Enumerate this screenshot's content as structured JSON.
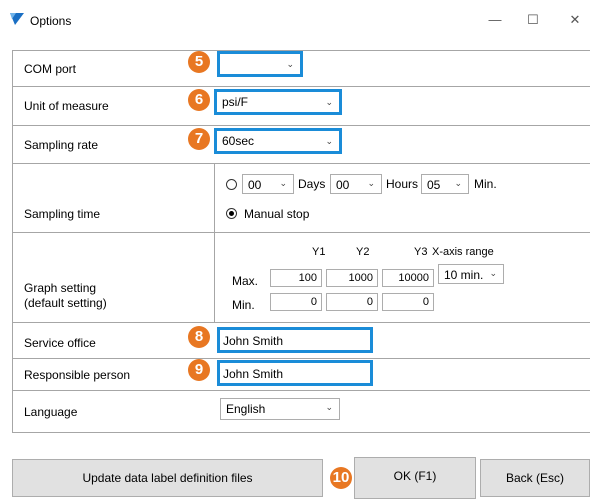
{
  "window": {
    "title": "Options",
    "minimize": "—",
    "maximize": "☐",
    "close": "✕"
  },
  "rows": {
    "com_port": {
      "label": "COM port",
      "value": ""
    },
    "unit": {
      "label": "Unit of measure",
      "value": "psi/F"
    },
    "sampling_rate": {
      "label": "Sampling rate",
      "value": "60sec"
    },
    "sampling_time": {
      "label": "Sampling time",
      "days_value": "00",
      "days_label": "Days",
      "hours_value": "00",
      "hours_label": "Hours",
      "min_value": "05",
      "min_label": "Min.",
      "manual_stop_label": "Manual stop",
      "selected": "manual_stop"
    },
    "graph": {
      "label_line1": "Graph setting",
      "label_line2": "(default setting)",
      "headers": {
        "y1": "Y1",
        "y2": "Y2",
        "y3": "Y3",
        "xaxis": "X-axis range"
      },
      "max_label": "Max.",
      "min_label": "Min.",
      "max": {
        "y1": "100",
        "y2": "1000",
        "y3": "10000"
      },
      "min": {
        "y1": "0",
        "y2": "0",
        "y3": "0"
      },
      "xaxis_value": "10 min."
    },
    "service_office": {
      "label": "Service office",
      "value": "John Smith"
    },
    "responsible": {
      "label": "Responsible person",
      "value": "John Smith"
    },
    "language": {
      "label": "Language",
      "value": "English"
    }
  },
  "buttons": {
    "update": "Update data label definition files",
    "ok": "OK (F1)",
    "back": "Back (Esc)"
  },
  "badges": {
    "b5": "5",
    "b6": "6",
    "b7": "7",
    "b8": "8",
    "b9": "9",
    "b10": "10"
  },
  "colors": {
    "highlight": "#1a8cd8",
    "badge": "#e87722"
  },
  "icons": {
    "app": "app-logo-icon",
    "dropdown": "chevron-down-icon"
  }
}
